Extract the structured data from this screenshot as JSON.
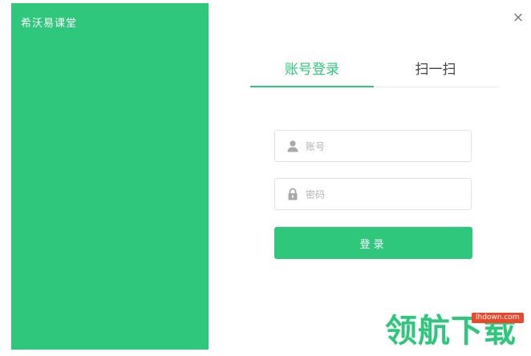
{
  "app": {
    "title": "希沃易课堂",
    "close_label": "×"
  },
  "tabs": [
    {
      "label": "账号登录",
      "active": true
    },
    {
      "label": "扫一扫",
      "active": false
    }
  ],
  "form": {
    "account": {
      "placeholder": "账号",
      "value": "",
      "icon": "user-icon"
    },
    "password": {
      "placeholder": "密码",
      "value": "",
      "icon": "lock-icon"
    },
    "login_label": "登录"
  },
  "watermark": {
    "text": "领航下载",
    "badge": "lhdown.com"
  },
  "colors": {
    "accent": "#2ec77b",
    "badge": "#e8492c"
  }
}
